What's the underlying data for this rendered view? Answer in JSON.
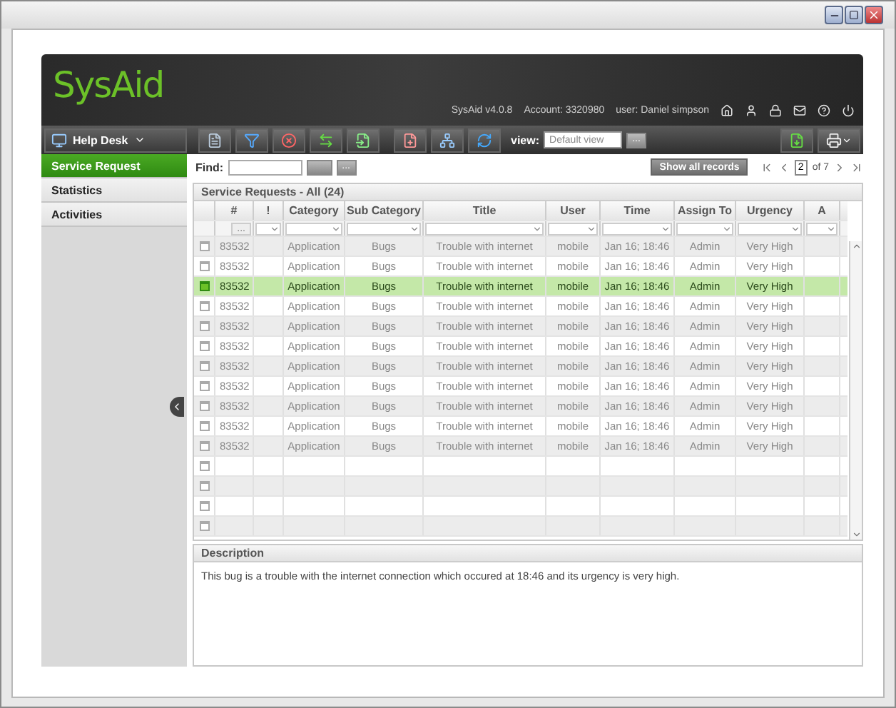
{
  "header": {
    "logo": "SysAid",
    "version": "SysAid v4.0.8",
    "account": "Account: 3320980",
    "user": "user: Daniel simpson"
  },
  "toolbar": {
    "module": "Help Desk",
    "view_label": "view:",
    "view_placeholder": "Default view",
    "view_button": "..."
  },
  "sidebar": {
    "items": [
      {
        "label": "Service Request",
        "selected": true
      },
      {
        "label": "Statistics",
        "selected": false
      },
      {
        "label": "Activities",
        "selected": false
      }
    ]
  },
  "find": {
    "label": "Find:",
    "more_button": "..."
  },
  "show_all": "Show all records",
  "pager": {
    "page": "2",
    "total": "of 7"
  },
  "grid": {
    "title": "Service Requests - All (24)",
    "columns": [
      {
        "label": "#",
        "kind": "text"
      },
      {
        "label": "!",
        "kind": "select"
      },
      {
        "label": "Category",
        "kind": "select"
      },
      {
        "label": "Sub Category",
        "kind": "select"
      },
      {
        "label": "Title",
        "kind": "select"
      },
      {
        "label": "User",
        "kind": "select"
      },
      {
        "label": "Time",
        "kind": "select"
      },
      {
        "label": "Assign To",
        "kind": "select"
      },
      {
        "label": "Urgency",
        "kind": "select"
      },
      {
        "label": "A",
        "kind": "select"
      }
    ],
    "text_filter_button": "...",
    "rows": [
      {
        "selected": false,
        "cells": [
          "83532",
          "",
          "Application",
          "Bugs",
          "Trouble with internet",
          "mobile",
          "Jan 16; 18:46",
          "Admin",
          "Very High",
          ""
        ]
      },
      {
        "selected": false,
        "cells": [
          "83532",
          "",
          "Application",
          "Bugs",
          "Trouble with internet",
          "mobile",
          "Jan 16; 18:46",
          "Admin",
          "Very High",
          ""
        ]
      },
      {
        "selected": true,
        "cells": [
          "83532",
          "",
          "Application",
          "Bugs",
          "Trouble with internet",
          "mobile",
          "Jan 16; 18:46",
          "Admin",
          "Very High",
          ""
        ]
      },
      {
        "selected": false,
        "cells": [
          "83532",
          "",
          "Application",
          "Bugs",
          "Trouble with internet",
          "mobile",
          "Jan 16; 18:46",
          "Admin",
          "Very High",
          ""
        ]
      },
      {
        "selected": false,
        "cells": [
          "83532",
          "",
          "Application",
          "Bugs",
          "Trouble with internet",
          "mobile",
          "Jan 16; 18:46",
          "Admin",
          "Very High",
          ""
        ]
      },
      {
        "selected": false,
        "cells": [
          "83532",
          "",
          "Application",
          "Bugs",
          "Trouble with internet",
          "mobile",
          "Jan 16; 18:46",
          "Admin",
          "Very High",
          ""
        ]
      },
      {
        "selected": false,
        "cells": [
          "83532",
          "",
          "Application",
          "Bugs",
          "Trouble with internet",
          "mobile",
          "Jan 16; 18:46",
          "Admin",
          "Very High",
          ""
        ]
      },
      {
        "selected": false,
        "cells": [
          "83532",
          "",
          "Application",
          "Bugs",
          "Trouble with internet",
          "mobile",
          "Jan 16; 18:46",
          "Admin",
          "Very High",
          ""
        ]
      },
      {
        "selected": false,
        "cells": [
          "83532",
          "",
          "Application",
          "Bugs",
          "Trouble with internet",
          "mobile",
          "Jan 16; 18:46",
          "Admin",
          "Very High",
          ""
        ]
      },
      {
        "selected": false,
        "cells": [
          "83532",
          "",
          "Application",
          "Bugs",
          "Trouble with internet",
          "mobile",
          "Jan 16; 18:46",
          "Admin",
          "Very High",
          ""
        ]
      },
      {
        "selected": false,
        "cells": [
          "83532",
          "",
          "Application",
          "Bugs",
          "Trouble with internet",
          "mobile",
          "Jan 16; 18:46",
          "Admin",
          "Very High",
          ""
        ]
      }
    ]
  },
  "description": {
    "title": "Description",
    "text": "This bug is a trouble with the internet connection which occured at 18:46 and its urgency is very high."
  }
}
